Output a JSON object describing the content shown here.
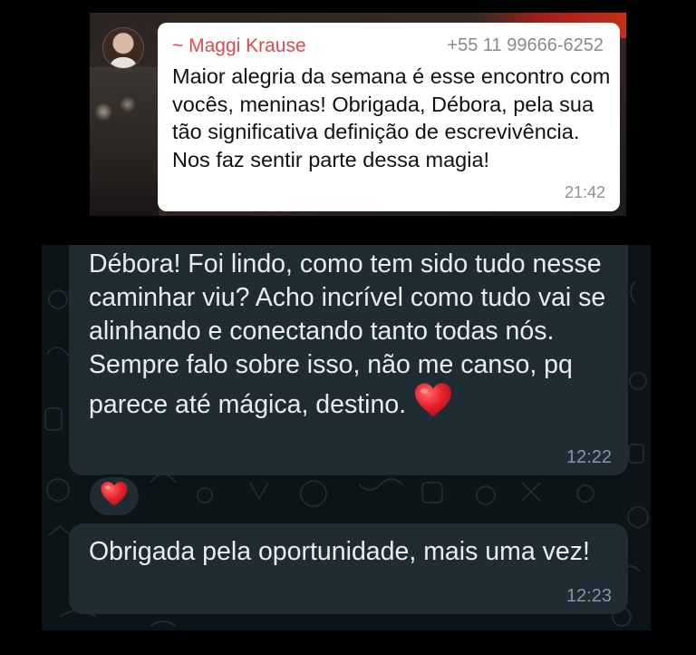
{
  "top_message": {
    "sender_name": "~ Maggi Krause",
    "sender_phone": "+55 11 99666-6252",
    "text": "Maior alegria da semana é esse encontro com vocês, meninas! Obrigada, Débora, pela sua tão significativa definição de escrevivência. Nos faz sentir parte dessa magia!",
    "time": "21:42"
  },
  "bottom_messages": [
    {
      "text": "Débora! Foi lindo, como tem sido tudo nesse caminhar viu? Acho incrível como tudo vai se alinhando e conectando tanto todas nós. Sempre falo sobre isso, não me canso, pq parece até mágica, destino.",
      "time": "12:22",
      "emoji": "red-heart-icon",
      "reaction": "red-heart-icon"
    },
    {
      "text": "Obrigada pela oportunidade, mais uma vez!",
      "time": "12:23"
    }
  ],
  "colors": {
    "sender_name": "#e0474c",
    "dark_bubble": "#202c33",
    "dark_background": "#0d1418",
    "heart": "#e8212e"
  }
}
